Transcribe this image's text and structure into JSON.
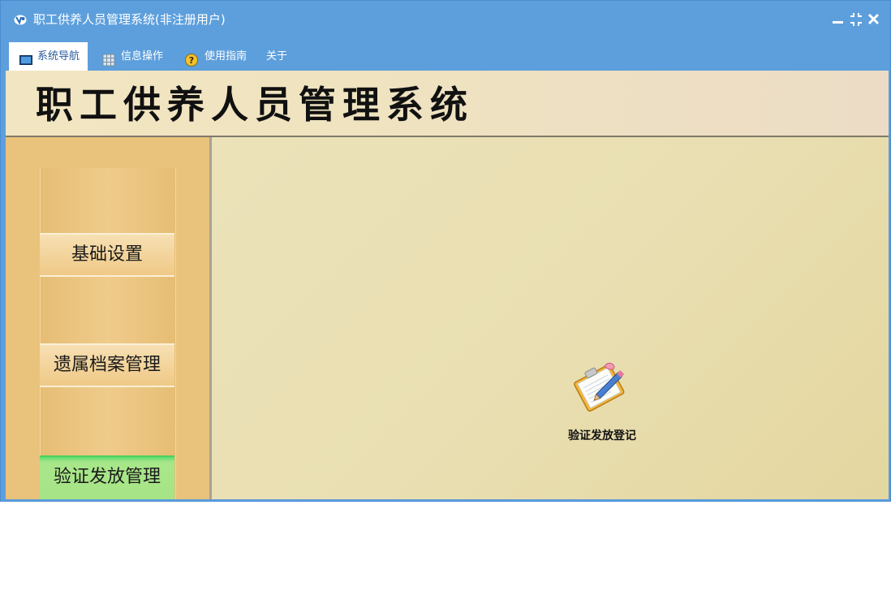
{
  "window": {
    "title": "职工供养人员管理系统(非注册用户)"
  },
  "menu": {
    "items": [
      {
        "label": "系统导航",
        "icon": "monitor-icon",
        "active": true
      },
      {
        "label": "信息操作",
        "icon": "grid-icon",
        "active": false
      },
      {
        "label": "使用指南",
        "icon": "help-icon",
        "active": false
      },
      {
        "label": "关于",
        "icon": "",
        "active": false
      }
    ]
  },
  "banner": {
    "title": "职工供养人员管理系统"
  },
  "sidebar": {
    "buttons": [
      {
        "label": "基础设置",
        "selected": false
      },
      {
        "label": "遗属档案管理",
        "selected": false
      },
      {
        "label": "验证发放管理",
        "selected": true
      }
    ]
  },
  "main": {
    "tasks": [
      {
        "label": "验证发放登记",
        "icon": "clipboard-pen-icon"
      }
    ]
  },
  "colors": {
    "title_bar": "#5d9fdc",
    "sidebar": "#e9c27c",
    "content_bg": "#e9dfb2",
    "selected_button": "#a6e486"
  }
}
